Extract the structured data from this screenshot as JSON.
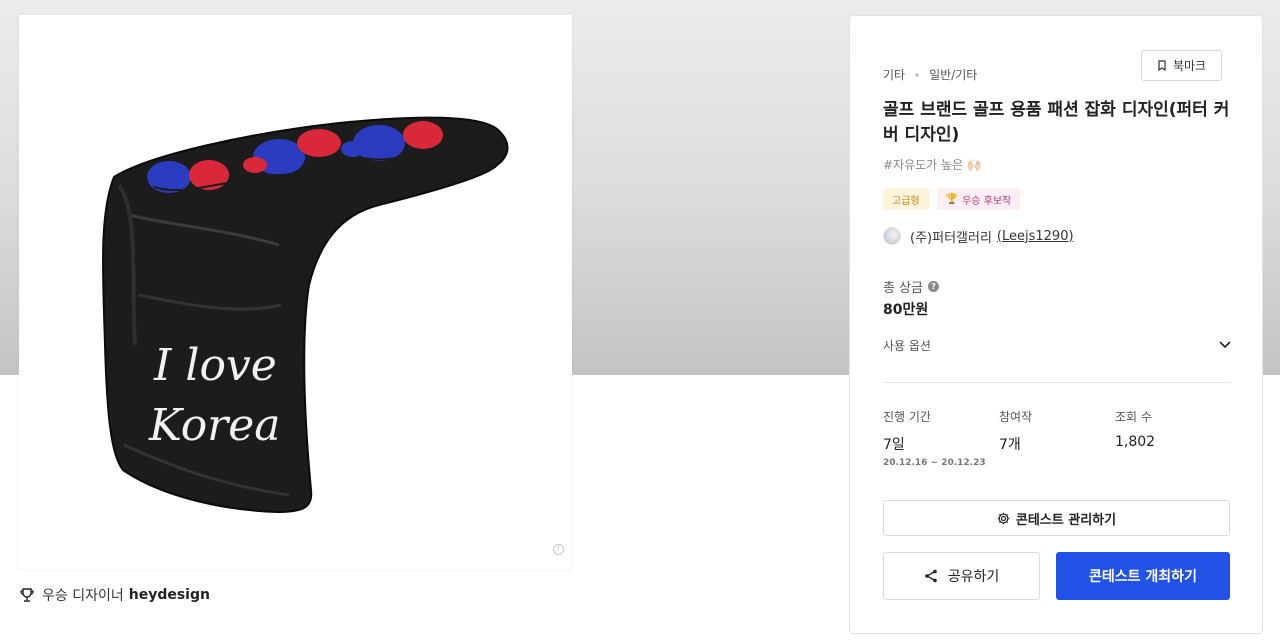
{
  "winner": {
    "label": "우승 디자이너",
    "name": "heydesign"
  },
  "artwork": {
    "line1": "I love",
    "line2": "Korea"
  },
  "crumbs": {
    "category": "기타",
    "subcategory": "일반/기타"
  },
  "bookmark_label": "북마크",
  "title": "골프 브랜드 골프 용품 패션 잡화 디자인(퍼터 커버 디자인)",
  "tagline": "#자유도가 높은 🙌🏻",
  "badges": {
    "premium": "고급형",
    "candidate": "우승 후보작"
  },
  "author": {
    "company": "(주)퍼터갤러리",
    "handle": "Leejs1290",
    "open": "(",
    "close": ")"
  },
  "prize": {
    "label": "총 상금",
    "help": "?",
    "value": "80만원"
  },
  "options_label": "사용 옵션",
  "stats": {
    "period_label": "진행 기간",
    "period_value": "7일",
    "period_range": "20.12.16  ~  20.12.23",
    "entries_label": "참여작",
    "entries_value": "7개",
    "views_label": "조회 수",
    "views_value": "1,802"
  },
  "manage_label": "콘테스트 관리하기",
  "share_label": "공유하기",
  "host_label": "콘테스트 개최하기",
  "colors": {
    "primary": "#2252e8",
    "premium_bg": "#fff3dc",
    "candidate_bg": "#fdeef6"
  },
  "icons": [
    "trophy-icon",
    "bookmark-icon",
    "help-icon",
    "chevron-down-icon",
    "gear-icon",
    "share-icon",
    "info-icon"
  ]
}
